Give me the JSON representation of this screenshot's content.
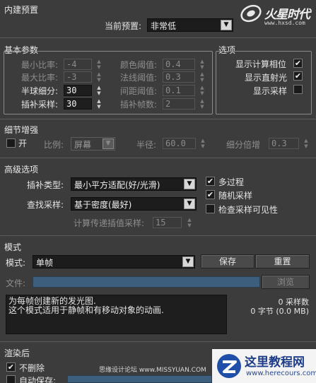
{
  "logo": {
    "brand": "火星时代",
    "url": "www.hxsd.com"
  },
  "preset": {
    "section_title": "内建预置",
    "label": "当前预置:",
    "value": "非常低"
  },
  "basic": {
    "section_title": "基本参数",
    "min_rate_label": "最小比率:",
    "min_rate": "-4",
    "max_rate_label": "最大比率:",
    "max_rate": "-3",
    "hemi_subdivs_label": "半球细分:",
    "hemi_subdivs": "30",
    "interp_samples_label": "插补采样:",
    "interp_samples": "30",
    "clr_thresh_label": "颜色阈值:",
    "clr_thresh": "0.4",
    "nrm_thresh_label": "法线阈值:",
    "nrm_thresh": "0.3",
    "dist_thresh_label": "间距阈值:",
    "dist_thresh": "0.1",
    "interp_frames_label": "插补帧数:",
    "interp_frames": "2"
  },
  "options": {
    "section_title": "选项",
    "show_calc_phase": "显示计算相位",
    "show_direct_light": "显示直射光",
    "show_samples": "显示采样",
    "show_calc_phase_checked": "✔",
    "show_direct_light_checked": "✔",
    "show_samples_checked": ""
  },
  "detail": {
    "section_title": "细节增强",
    "on_label": "开",
    "scale_label": "比例:",
    "scale_value": "屏幕",
    "radius_label": "半径:",
    "radius_value": "60.0",
    "subdivs_mult_label": "细分倍增",
    "subdivs_mult_value": "0.3"
  },
  "advanced": {
    "section_title": "高级选项",
    "interp_type_label": "插补类型:",
    "interp_type_value": "最小平方适配(好/光滑)",
    "lookup_label": "查找采样:",
    "lookup_value": "基于密度(最好)",
    "calc_pass_label": "计算传递插值采样:",
    "calc_pass_value": "15",
    "multipass": "多过程",
    "multipass_checked": "✔",
    "randomize": "随机采样",
    "randomize_checked": "✔",
    "check_visibility": "检查采样可见性",
    "check_visibility_checked": ""
  },
  "mode": {
    "section_title": "模式",
    "mode_label": "模式:",
    "mode_value": "单帧",
    "save_button": "保存",
    "reset_button": "重置",
    "file_label": "文件:",
    "browse_button": "浏览",
    "description_line1": "为每帧创建新的发光图.",
    "description_line2": "这个模式适用于静帧和有移动对象的动画.",
    "samples_stat": "0 采样数",
    "bytes_stat": "0 字节 (0.0 MB)"
  },
  "after_render": {
    "section_title": "渲染后",
    "dont_delete": "不删除",
    "dont_delete_checked": "✔",
    "auto_save": "自动保存:",
    "auto_save_checked": ""
  },
  "watermarks": {
    "left": "思缘设计论坛 www.MISSYUAN.COM",
    "right_title": "这里教程网",
    "right_url": "www.herecours.com"
  }
}
